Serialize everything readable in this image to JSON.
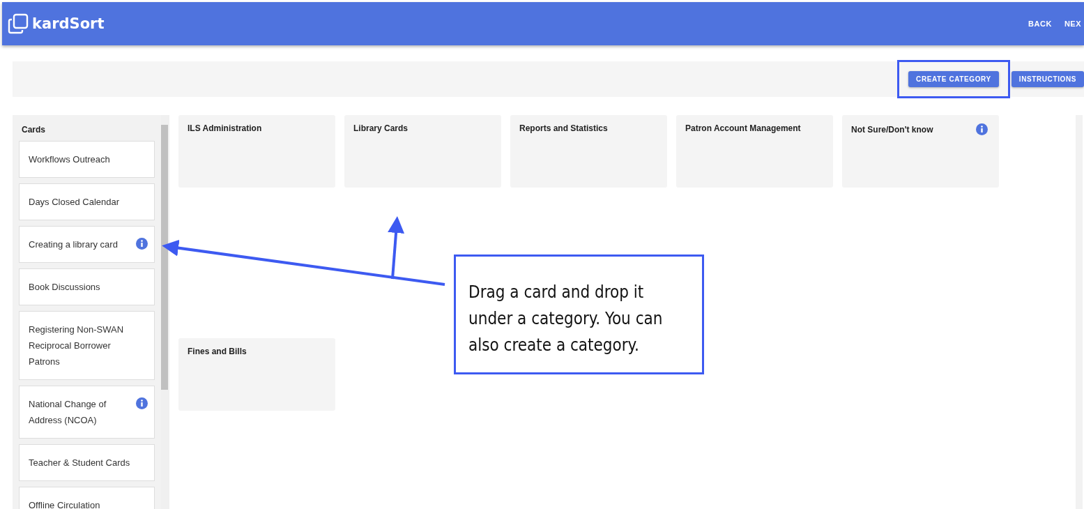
{
  "header": {
    "logo": "kardSort",
    "nav": [
      "BACK",
      "NEX"
    ]
  },
  "toolbar": {
    "buttons": [
      {
        "label": "CREATE CATEGORY",
        "highlighted": true
      },
      {
        "label": "INSTRUCTIONS",
        "highlighted": false
      }
    ]
  },
  "cards_panel": {
    "title": "Cards",
    "cards": [
      {
        "label": "Workflows Outreach",
        "info": false
      },
      {
        "label": "Days Closed Calendar",
        "info": false
      },
      {
        "label": "Creating a library card",
        "info": true
      },
      {
        "label": "Book Discussions",
        "info": false
      },
      {
        "label": "Registering Non-SWAN Reciprocal Borrower Patrons",
        "info": false
      },
      {
        "label": "National Change of Address (NCOA)",
        "info": true
      },
      {
        "label": "Teacher & Student Cards",
        "info": false
      },
      {
        "label": "Offline Circulation",
        "info": false
      }
    ]
  },
  "categories": [
    {
      "title": "ILS Administration",
      "info": false
    },
    {
      "title": "Library Cards",
      "info": false
    },
    {
      "title": "Reports and Statistics",
      "info": false
    },
    {
      "title": "Patron Account Management",
      "info": false
    },
    {
      "title": "Not Sure/Don't know",
      "info": true
    },
    {
      "title": "Fines and Bills",
      "info": false
    }
  ],
  "callout": {
    "text": "Drag a card and drop it under a category. You can also create a category."
  }
}
